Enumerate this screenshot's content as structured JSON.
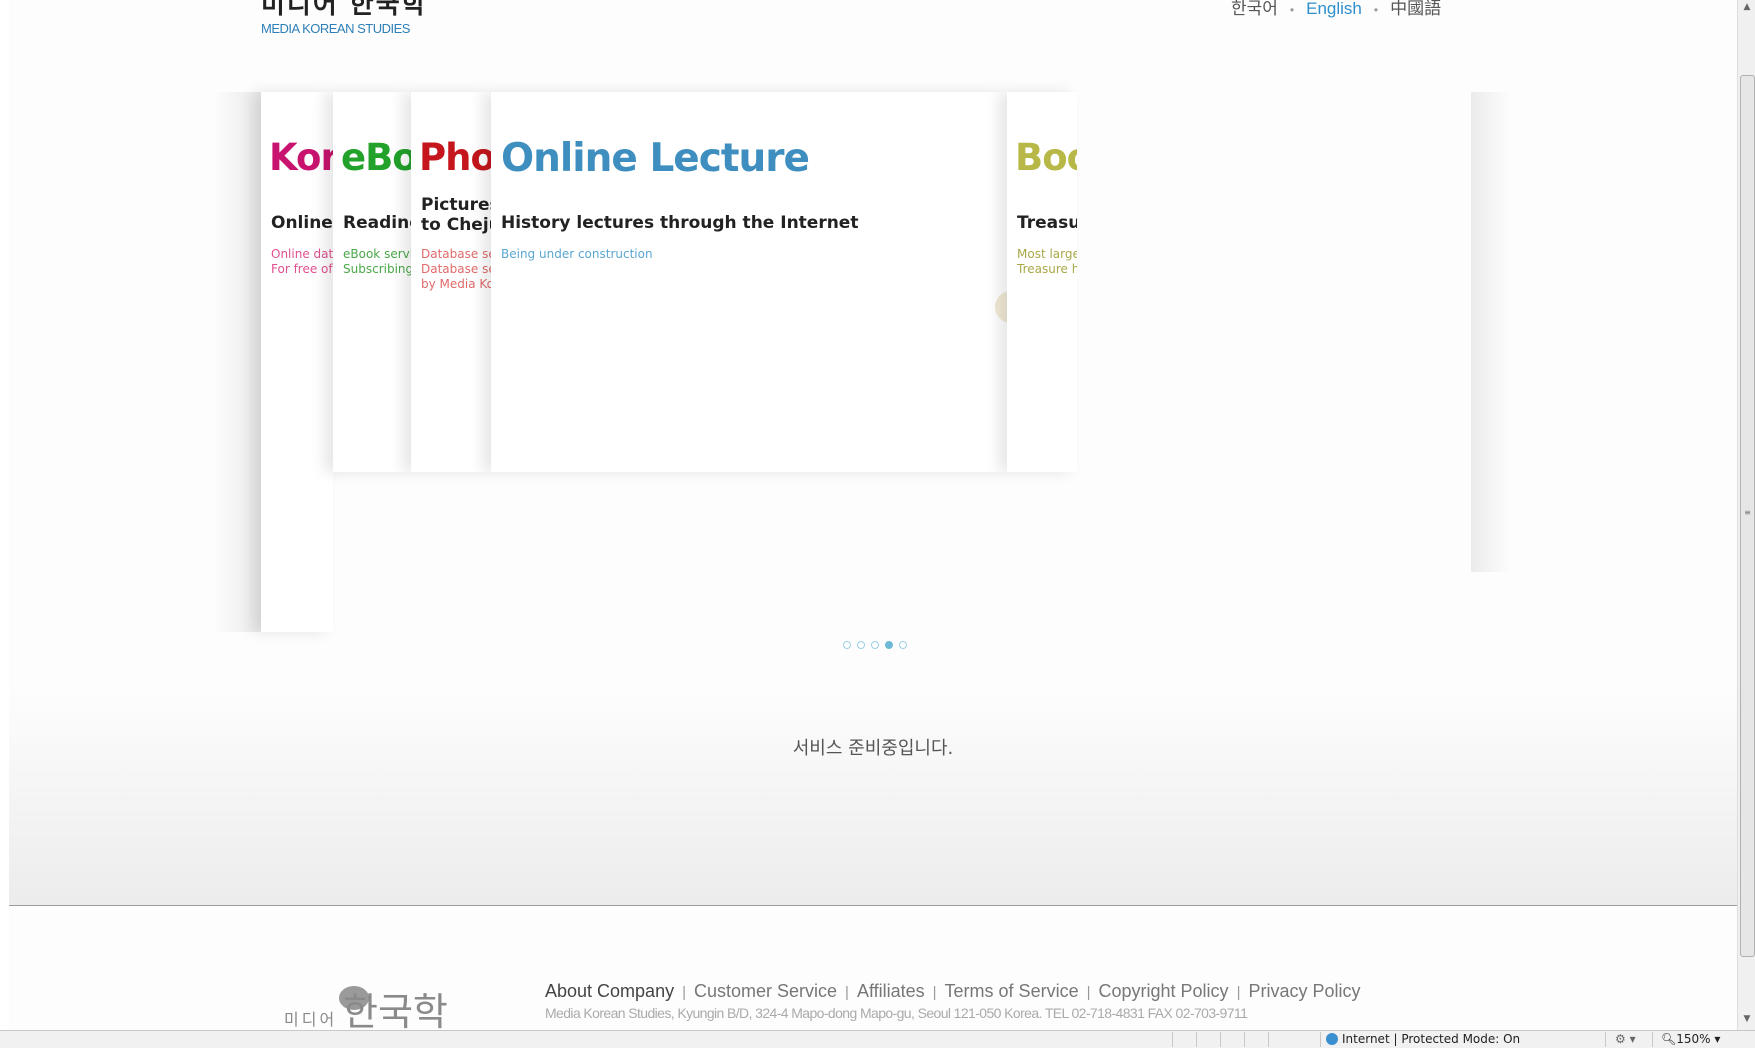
{
  "header": {
    "logo_korean": "미디어 한국학",
    "logo_english": "MEDIA KOREAN STUDIES",
    "languages": [
      "한국어",
      "English",
      "中國語"
    ],
    "active_language": "English"
  },
  "slider": {
    "panels": [
      {
        "title": "Kor",
        "subtitle": "Online s",
        "desc": "Online data\nFor free of p",
        "color": "#c8146e",
        "desc_color": "#e0508f"
      },
      {
        "title": "eBo",
        "subtitle": "Reading",
        "desc": "eBook servi\nSubscribing",
        "color": "#22a22a",
        "desc_color": "#4aa84a"
      },
      {
        "title": "Pho",
        "subtitle": "Pictures\nto Cheju",
        "desc": "Database se\nDatabase se\nby Media Ko",
        "color": "#c4161c",
        "desc_color": "#e06a6a"
      },
      {
        "title": "Online Lecture",
        "subtitle": "History lectures through the Internet",
        "desc": "Being under construction",
        "color": "#3e8fc0",
        "desc_color": "#5aa7d2"
      },
      {
        "title": "Boo",
        "subtitle": "Treasu",
        "desc": "Most large\nTreasure h",
        "color": "#b8b848",
        "desc_color": "#a8a848"
      }
    ],
    "dots": 5,
    "active_dot": 3
  },
  "notice": {
    "text": "서비스 준비중입니다."
  },
  "footer": {
    "logo_small": "미디어",
    "logo_big": "한국학",
    "links": [
      "About Company",
      "Customer Service",
      "Affiliates",
      "Terms of Service",
      "Copyright Policy",
      "Privacy Policy"
    ],
    "address": "Media Korean Studies, Kyungin B/D, 324-4 Mapo-dong Mapo-gu, Seoul 121-050 Korea. TEL 02-718-4831 FAX 02-703-9711"
  },
  "statusbar": {
    "zone": "Internet | Protected Mode: On",
    "zoom": "150%"
  }
}
